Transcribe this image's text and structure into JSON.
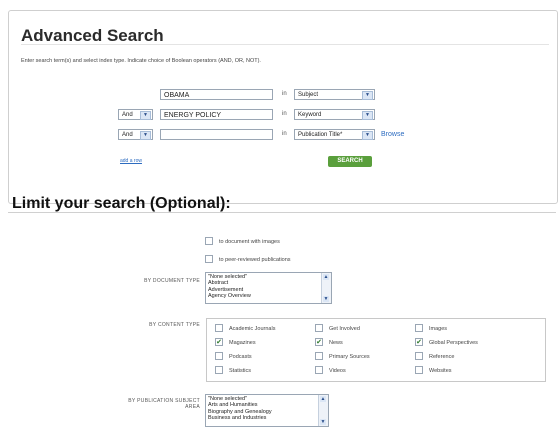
{
  "advanced": {
    "title": "Advanced Search",
    "instructions": "Enter search term(s) and select index type. Indicate choice of Boolean operators (AND, OR, NOT).",
    "rows": [
      {
        "operator": "",
        "term": "OBAMA",
        "in_label": "in",
        "index": "Subject"
      },
      {
        "operator": "And",
        "term": "ENERGY POLICY",
        "in_label": "in",
        "index": "Keyword"
      },
      {
        "operator": "And",
        "term": "",
        "in_label": "in",
        "index": "Publication Title*"
      }
    ],
    "browse_label": "Browse",
    "add_row_label": "add a row",
    "search_label": "SEARCH"
  },
  "limit": {
    "title": "Limit your search (Optional):",
    "images_label": "to document with images",
    "peer_label": "to peer-reviewed publications",
    "doc_type_label": "BY DOCUMENT TYPE",
    "doc_type_options": [
      "\"None selected\"",
      "Abstract",
      "Advertisement",
      "Agency Overview"
    ],
    "content_type_label": "BY CONTENT TYPE",
    "content_types": [
      {
        "label": "Academic Journals",
        "checked": false
      },
      {
        "label": "Get Involved",
        "checked": false
      },
      {
        "label": "Images",
        "checked": false
      },
      {
        "label": "Magazines",
        "checked": true
      },
      {
        "label": "News",
        "checked": true
      },
      {
        "label": "Global Perspectives",
        "checked": true
      },
      {
        "label": "Podcasts",
        "checked": false
      },
      {
        "label": "Primary Sources",
        "checked": false
      },
      {
        "label": "Reference",
        "checked": false
      },
      {
        "label": "Statistics",
        "checked": false
      },
      {
        "label": "Videos",
        "checked": false
      },
      {
        "label": "Websites",
        "checked": false
      }
    ],
    "subject_label_1": "BY PUBLICATION SUBJECT",
    "subject_label_2": "AREA",
    "subject_options": [
      "\"None selected\"",
      "Arts and Humanities",
      "Biography and Genealogy",
      "Business and Industries"
    ]
  },
  "icons": {
    "check": "✔",
    "arrow_down": "▼",
    "arrow_up": "▲"
  }
}
